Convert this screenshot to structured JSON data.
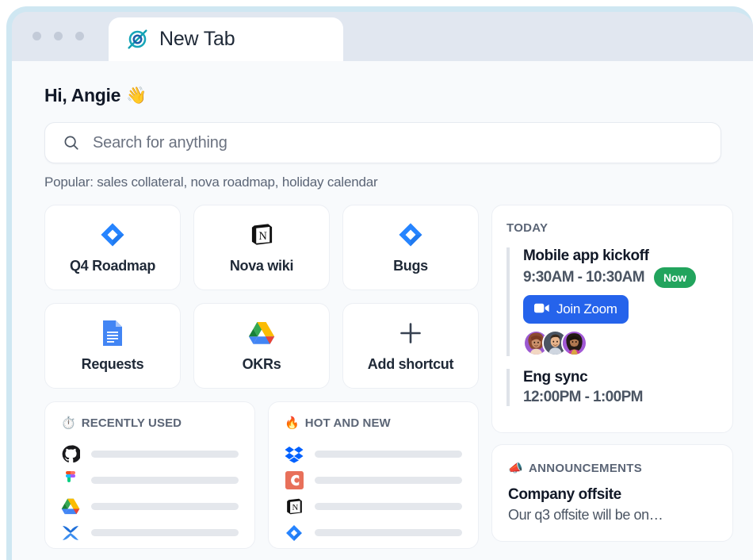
{
  "window": {
    "traffic_lights": [
      "close",
      "minimize",
      "maximize"
    ],
    "tab": {
      "title": "New Tab",
      "icon": "target-logo-icon"
    }
  },
  "header": {
    "greeting": "Hi, Angie",
    "greeting_emoji": "👋"
  },
  "search": {
    "placeholder": "Search for anything",
    "icon": "search-icon",
    "value": "",
    "popular_label": "Popular: sales collateral, nova roadmap, holiday calendar"
  },
  "shortcuts": {
    "tiles": [
      {
        "label": "Q4 Roadmap",
        "icon": "jira-icon"
      },
      {
        "label": "Nova wiki",
        "icon": "notion-icon"
      },
      {
        "label": "Bugs",
        "icon": "jira-icon"
      },
      {
        "label": "Requests",
        "icon": "google-docs-icon"
      },
      {
        "label": "OKRs",
        "icon": "google-drive-icon"
      },
      {
        "label": "Add shortcut",
        "icon": "plus-icon"
      }
    ]
  },
  "recently_used": {
    "title": "RECENTLY USED",
    "emoji": "⏱️",
    "rows": [
      {
        "icon": "github-icon"
      },
      {
        "icon": "figma-icon"
      },
      {
        "icon": "google-drive-icon"
      },
      {
        "icon": "airtable-x-icon"
      }
    ]
  },
  "hot_and_new": {
    "title": "HOT AND NEW",
    "emoji": "🔥",
    "rows": [
      {
        "icon": "dropbox-icon"
      },
      {
        "icon": "confluence-c-icon"
      },
      {
        "icon": "notion-icon"
      },
      {
        "icon": "jira-icon"
      }
    ]
  },
  "today": {
    "title": "TODAY",
    "events": [
      {
        "name": "Mobile app kickoff",
        "time": "9:30AM - 10:30AM",
        "badge": "Now",
        "action_label": "Join Zoom",
        "action_icon": "video-camera-icon",
        "attendees": [
          "attendee-1",
          "attendee-2",
          "attendee-3"
        ]
      },
      {
        "name": "Eng sync",
        "time": "12:00PM - 1:00PM",
        "badge": "",
        "action_label": "",
        "attendees": []
      }
    ]
  },
  "announcements": {
    "title": "ANNOUNCEMENTS",
    "emoji": "📣",
    "item_title": "Company offsite",
    "item_body": "Our q3 offsite will be on…"
  },
  "colors": {
    "accent_blue": "#2563eb",
    "badge_green": "#22a45d",
    "tab_teal": "#0f9fb0",
    "jira_blue": "#2684ff",
    "text_dark": "#111827",
    "text_muted": "#5b6576",
    "page_bg": "#f8fafc",
    "chrome_bg": "#e1e7f0",
    "window_glow": "#cfe7f2"
  }
}
